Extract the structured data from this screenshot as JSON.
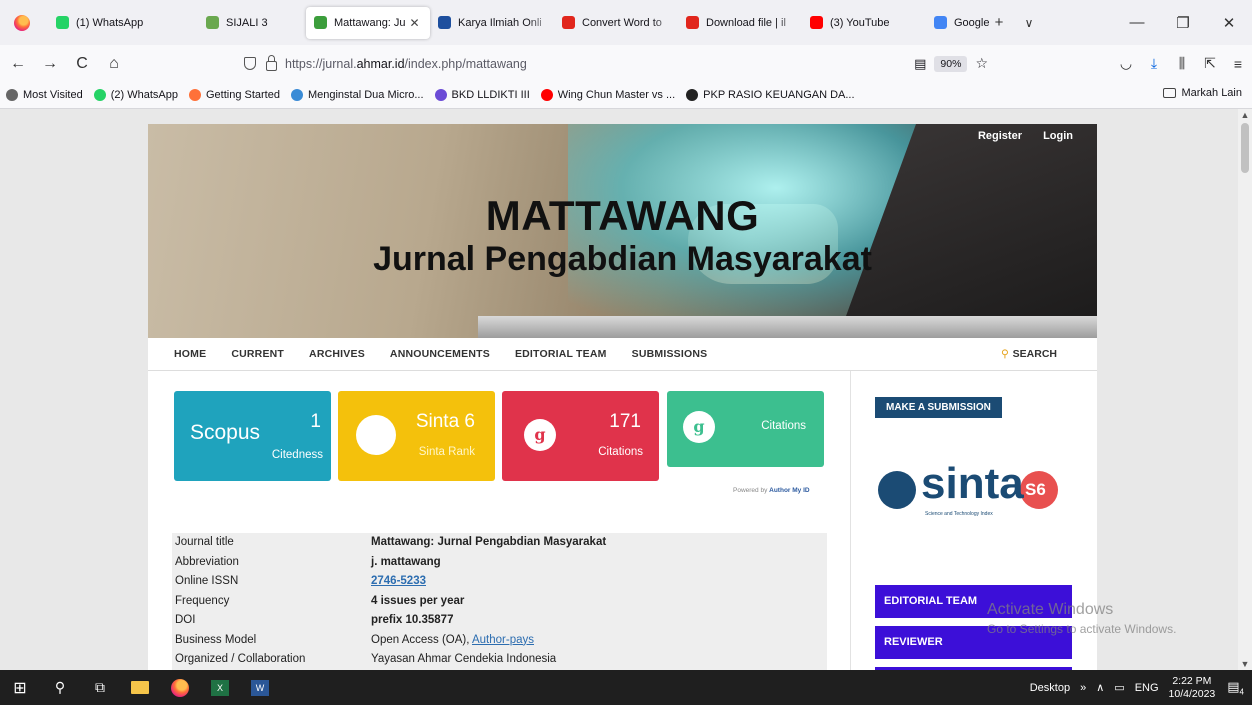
{
  "browser": {
    "tabs": [
      {
        "label": "(1) WhatsApp",
        "fav": "#25d366"
      },
      {
        "label": "SIJALI 3",
        "fav": "#6aa84f"
      },
      {
        "label": "Mattawang: Ju",
        "fav": "#3c9e3c"
      },
      {
        "label": "Karya Ilmiah Onli",
        "fav": "#1e4f9e"
      },
      {
        "label": "Convert Word to",
        "fav": "#e1261c"
      },
      {
        "label": "Download file | il",
        "fav": "#e1261c"
      },
      {
        "label": "(3) YouTube",
        "fav": "#ff0000"
      },
      {
        "label": "Google",
        "fav": "#4285f4"
      }
    ],
    "new_tab": "+",
    "tab_list": "∨",
    "minimize": "—",
    "restore": "❐",
    "close": "✕",
    "url_prefix": "https://jurnal.",
    "url_domain": "ahmar.id",
    "url_path": "/index.php/mattawang",
    "zoom": "90%",
    "bookmarks": [
      {
        "label": "Most Visited",
        "color": "#666"
      },
      {
        "label": "(2) WhatsApp",
        "color": "#25d366"
      },
      {
        "label": "Getting Started",
        "color": "#ff7139"
      },
      {
        "label": "Menginstal Dua Micro...",
        "color": "#3a8bd6"
      },
      {
        "label": "BKD LLDIKTI III",
        "color": "#6b4bd6"
      },
      {
        "label": "Wing Chun Master vs ...",
        "color": "#ff0000"
      },
      {
        "label": "PKP RASIO KEUANGAN DA...",
        "color": "#222"
      }
    ],
    "other_bookmarks": "Markah Lain"
  },
  "site": {
    "banner_title": "MATTAWANG",
    "banner_subtitle": "Jurnal Pengabdian Masyarakat",
    "register": "Register",
    "login": "Login",
    "nav": [
      "HOME",
      "CURRENT",
      "ARCHIVES",
      "ANNOUNCEMENTS",
      "EDITORIAL TEAM",
      "SUBMISSIONS"
    ],
    "search": "SEARCH"
  },
  "cards": {
    "scopus": {
      "brand": "Scopus",
      "value": "1",
      "label": "Citedness",
      "color": "#1fa3bd"
    },
    "sinta": {
      "brand": "Sinta 6",
      "label": "Sinta Rank",
      "color": "#f4c10c"
    },
    "gscholar": {
      "value": "171",
      "label": "Citations",
      "color": "#e0334b"
    },
    "garuda": {
      "label": "Citations",
      "color": "#3cbf8f"
    },
    "powered_by": "Powered by",
    "powered_brand": "Author My ID"
  },
  "info": [
    {
      "k": "Journal title",
      "v": "Mattawang: Jurnal Pengabdian Masyarakat",
      "bold": true
    },
    {
      "k": "Abbreviation",
      "v": "j. mattawang",
      "bold": true
    },
    {
      "k": "Online ISSN",
      "v": "2746-5233",
      "bold": true,
      "link": true
    },
    {
      "k": "Frequency",
      "v": "4 issues per year",
      "bold": true
    },
    {
      "k": "DOI",
      "v": "prefix 10.35877",
      "bold": true
    },
    {
      "k": "Business Model",
      "v": "Open Access (OA), ",
      "link_text": "Author-pays"
    },
    {
      "k": "Organized / Collaboration",
      "v": "Yayasan Ahmar Cendekia Indonesia"
    }
  ],
  "sidebar": {
    "make_submission": "MAKE A SUBMISSION",
    "sinta_word": "sinta",
    "sinta_badge": "S6",
    "sinta_caption": "Science and Technology Index",
    "buttons": [
      "EDITORIAL TEAM",
      "REVIEWER"
    ]
  },
  "watermark": {
    "line1": "Activate Windows",
    "line2": "Go to Settings to activate Windows."
  },
  "taskbar": {
    "desktop": "Desktop",
    "lang": "ENG",
    "time": "2:22 PM",
    "date": "10/4/2023",
    "notif": "4"
  }
}
